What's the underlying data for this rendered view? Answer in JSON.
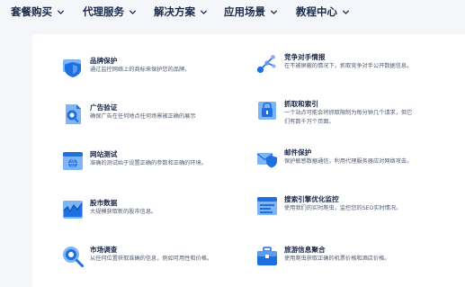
{
  "nav": [
    {
      "label": "套餐购买"
    },
    {
      "label": "代理服务"
    },
    {
      "label": "解决方案"
    },
    {
      "label": "应用场景"
    },
    {
      "label": "教程中心"
    }
  ],
  "colors": {
    "accent": "#1e6fe0",
    "accent_light": "#7fb4f5",
    "title": "#1b2744",
    "desc": "#4f5a6e"
  },
  "cards": [
    {
      "title": "品牌保护",
      "desc": "通过监控网络上的商标来保护您的品牌。",
      "icon": "brand-shield-icon"
    },
    {
      "title": "竞争对手情报",
      "desc": "在不被屏蔽的情况下，抓取竞争对手公开数据信息。",
      "icon": "competitor-network-icon"
    },
    {
      "title": "广告验证",
      "desc": "确保广告在任何地点任何场景被正确的展示",
      "icon": "ad-verification-icon"
    },
    {
      "title": "抓取和索引",
      "desc": "一个站点可能会将抓取限制为每分钟几个请求，但它们有数千万个页面。",
      "icon": "crawl-index-icon"
    },
    {
      "title": "网站测试",
      "desc": "准确的测试始于设置正确的参数和正确的环境。",
      "icon": "website-test-icon"
    },
    {
      "title": "邮件保护",
      "desc": "保护敏感数据通信，利用代理服务器应对网络攻击。",
      "icon": "email-protection-icon"
    },
    {
      "title": "股市数据",
      "desc": "大规模获取新的股市信息。",
      "icon": "stock-chart-icon"
    },
    {
      "title": "搜索引擎优化监控",
      "desc": "使用我们的实时爬虫，监控您的SEO实时情况。",
      "icon": "seo-monitor-icon"
    },
    {
      "title": "市场调查",
      "desc": "从任何位置获取准确的信息，例如可用性和价格。",
      "icon": "market-research-icon"
    },
    {
      "title": "旅游信息聚合",
      "desc": "使用爬虫获取正确的机票价格和酒店价格。",
      "icon": "travel-suitcase-icon"
    }
  ]
}
